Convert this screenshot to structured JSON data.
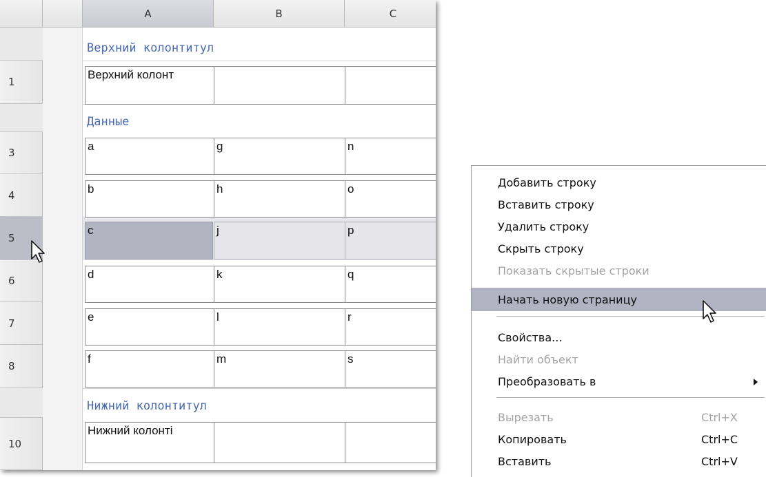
{
  "sheet": {
    "columns": [
      "A",
      "B",
      "C"
    ],
    "selected_column": "A",
    "bands": {
      "header": "Верхний колонтитул",
      "data": "Данные",
      "footer": "Нижний колонтитул"
    },
    "rows": [
      {
        "num": "1",
        "cells": [
          "Верхний колонт",
          "",
          ""
        ]
      },
      {
        "num": "3",
        "cells": [
          "a",
          "g",
          "n"
        ]
      },
      {
        "num": "4",
        "cells": [
          "b",
          "h",
          "o"
        ]
      },
      {
        "num": "5",
        "cells": [
          "c",
          "j",
          "p"
        ]
      },
      {
        "num": "6",
        "cells": [
          "d",
          "k",
          "q"
        ]
      },
      {
        "num": "7",
        "cells": [
          "e",
          "l",
          "r"
        ]
      },
      {
        "num": "8",
        "cells": [
          "f",
          "m",
          "s"
        ]
      },
      {
        "num": "10",
        "cells": [
          "Нижний колонті",
          "",
          ""
        ]
      }
    ],
    "selected_row": "5",
    "selected_cell": "A5"
  },
  "context_menu": {
    "items": [
      {
        "label": "Добавить строку",
        "enabled": true
      },
      {
        "label": "Вставить строку",
        "enabled": true
      },
      {
        "label": "Удалить строку",
        "enabled": true
      },
      {
        "label": "Скрыть строку",
        "enabled": true
      },
      {
        "label": "Показать скрытые строки",
        "enabled": false
      },
      {
        "label": "Начать новую страницу",
        "enabled": true,
        "highlighted": true
      },
      {
        "label": "Свойства...",
        "enabled": true
      },
      {
        "label": "Найти объект",
        "enabled": false
      },
      {
        "label": "Преобразовать в",
        "enabled": true,
        "submenu": true
      },
      {
        "label": "Вырезать",
        "shortcut": "Ctrl+X",
        "enabled": false
      },
      {
        "label": "Копировать",
        "shortcut": "Ctrl+C",
        "enabled": true
      },
      {
        "label": "Вставить",
        "shortcut": "Ctrl+V",
        "enabled": true
      }
    ]
  },
  "icons": [
    "arrow-cursor-icon",
    "submenu-arrow-icon"
  ],
  "colors": {
    "band_title": "#4a6bb0",
    "selection": "#b3b4c2",
    "menu_highlight": "#b1b3c3",
    "disabled_text": "#a4a4a4"
  }
}
